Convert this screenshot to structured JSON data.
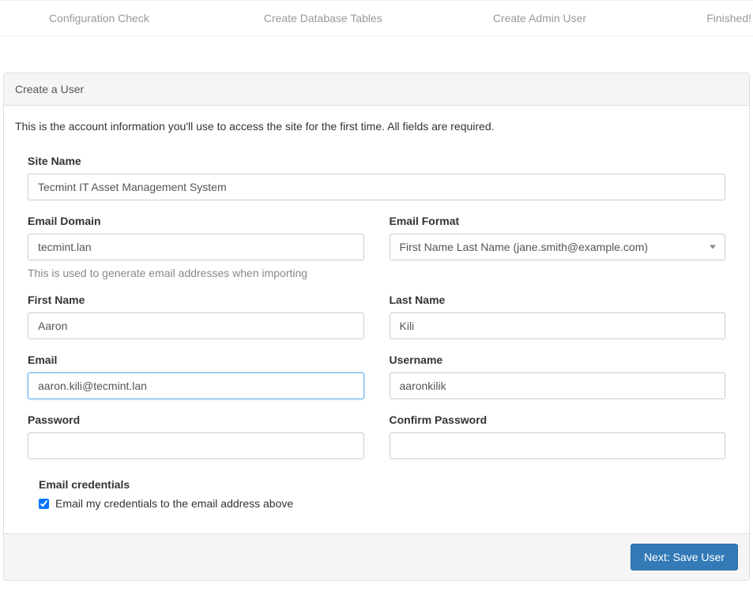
{
  "steps": {
    "config": "Configuration Check",
    "tables": "Create Database Tables",
    "admin": "Create Admin User",
    "finished": "Finished!"
  },
  "panel": {
    "title": "Create a User",
    "intro": "This is the account information you'll use to access the site for the first time. All fields are required."
  },
  "form": {
    "site_name": {
      "label": "Site Name",
      "value": "Tecmint IT Asset Management System"
    },
    "email_domain": {
      "label": "Email Domain",
      "value": "tecmint.lan",
      "help": "This is used to generate email addresses when importing"
    },
    "email_format": {
      "label": "Email Format",
      "selected": "First Name Last Name (jane.smith@example.com)"
    },
    "first_name": {
      "label": "First Name",
      "value": "Aaron"
    },
    "last_name": {
      "label": "Last Name",
      "value": "Kili"
    },
    "email": {
      "label": "Email",
      "value": "aaron.kili@tecmint.lan"
    },
    "username": {
      "label": "Username",
      "value": "aaronkilik"
    },
    "password": {
      "label": "Password",
      "value": ""
    },
    "confirm_password": {
      "label": "Confirm Password",
      "value": ""
    },
    "email_creds": {
      "heading": "Email credentials",
      "label": "Email my credentials to the email address above",
      "checked": true
    }
  },
  "footer": {
    "submit": "Next: Save User"
  }
}
